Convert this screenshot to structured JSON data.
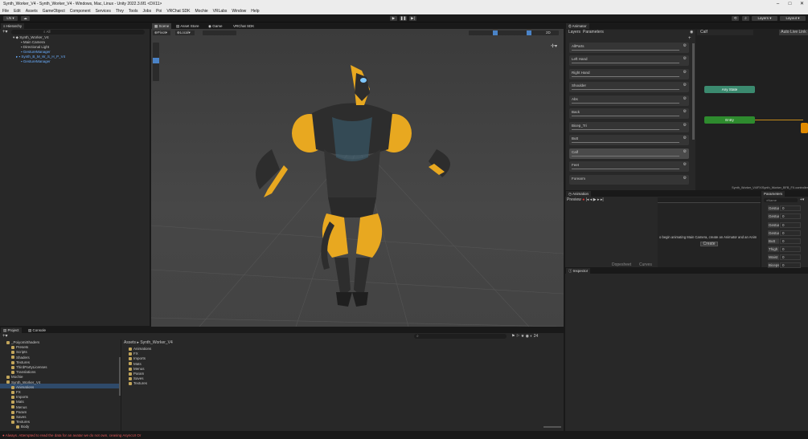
{
  "window": {
    "title": "Synth_Worker_V4 - Synth_Worker_V4 - Windows, Mac, Linux - Unity 2022.3.6f1 <DX11>",
    "controls": [
      "–",
      "□",
      "✕"
    ]
  },
  "menu": [
    "File",
    "Edit",
    "Assets",
    "GameObject",
    "Component",
    "Services",
    "Thry",
    "Tools",
    "Jobs",
    "Poi",
    "VRChat SDK",
    "Mochie",
    "VRLabs",
    "Window",
    "Help"
  ],
  "toolbar": {
    "account": "LN",
    "layers": "Layers",
    "layout": "Layout"
  },
  "hierarchy": {
    "title": "Hierarchy",
    "search_placeholder": "All",
    "items": [
      "Synth_Worker_V4",
      "Main Camera",
      "Directional Light",
      "GestureManager",
      "Synth_B_M_W_S_H_P_V4",
      "GestureManager"
    ]
  },
  "scene": {
    "tabs": [
      "Scene",
      "Asset Store",
      "Game",
      "VRChat SDK"
    ],
    "pivot": "Pivot",
    "space": "Local",
    "mode": "2D"
  },
  "animator": {
    "title": "Animator",
    "subtabs": [
      "Layers",
      "Parameters"
    ],
    "breadcrumb": "Calf",
    "auto_live": "Auto Live Link",
    "layers": [
      "AllParts",
      "Left Hand",
      "Right Hand",
      "Shoulder",
      "Abs",
      "Back",
      "Bicep_Tri",
      "Butt",
      "Calf",
      "Feet",
      "Forearm"
    ],
    "nodes": {
      "any_state": "Any State",
      "entry": "Entry"
    },
    "path": "Synth_Worker_V4/FX/Synth_Worker_BFB_FX.controller"
  },
  "animation": {
    "title": "Animation",
    "preview": "Preview",
    "message": "o begin animating Main Camera, create an Animator and an Anim",
    "create": "Create",
    "tabs": [
      "Dopesheet",
      "Curves"
    ]
  },
  "parameters": {
    "title": "Parameters",
    "search_placeholder": "Name",
    "items": [
      {
        "name": "Gestur",
        "value": "0"
      },
      {
        "name": "Gestur",
        "value": "0"
      },
      {
        "name": "Gestur",
        "value": "0"
      },
      {
        "name": "Gestur",
        "value": "0"
      },
      {
        "name": "Butt",
        "value": "0"
      },
      {
        "name": "Thigh",
        "value": "0"
      },
      {
        "name": "Waist",
        "value": "0"
      },
      {
        "name": "Biceps",
        "value": "0"
      }
    ]
  },
  "inspector": {
    "title": "Inspector"
  },
  "project": {
    "tabs": [
      "Project",
      "Console"
    ],
    "tree": [
      {
        "label": "_PoiyomiShaders",
        "indent": 0
      },
      {
        "label": "Presets",
        "indent": 1
      },
      {
        "label": "Scripts",
        "indent": 1
      },
      {
        "label": "Shaders",
        "indent": 1
      },
      {
        "label": "Textures",
        "indent": 1
      },
      {
        "label": "ThirdPartyLicenses",
        "indent": 1
      },
      {
        "label": "Translations",
        "indent": 1
      },
      {
        "label": "Mochie",
        "indent": 0
      },
      {
        "label": "Synth_Worker_V4",
        "indent": 0
      },
      {
        "label": "Animations",
        "indent": 1
      },
      {
        "label": "FX",
        "indent": 1
      },
      {
        "label": "Imports",
        "indent": 1
      },
      {
        "label": "Mats",
        "indent": 1
      },
      {
        "label": "Menus",
        "indent": 1
      },
      {
        "label": "Param",
        "indent": 1
      },
      {
        "label": "Saves",
        "indent": 1
      },
      {
        "label": "Textures",
        "indent": 1
      },
      {
        "label": "Body",
        "indent": 2
      }
    ],
    "breadcrumb": [
      "Assets",
      "Synth_Worker_V4"
    ],
    "folders": [
      "Animations",
      "FX",
      "Imports",
      "Mats",
      "Menus",
      "Param",
      "Saves",
      "Textures"
    ],
    "count": "24"
  },
  "status": {
    "message": "Always. Attempted to read the data for an avatar we do not own, ceasing AsyncUI Or"
  },
  "colors": {
    "any_state": "#3b8a6f",
    "entry": "#2e8b2e",
    "accent": "#ffc51f",
    "body_dark": "#2d2d2d"
  }
}
